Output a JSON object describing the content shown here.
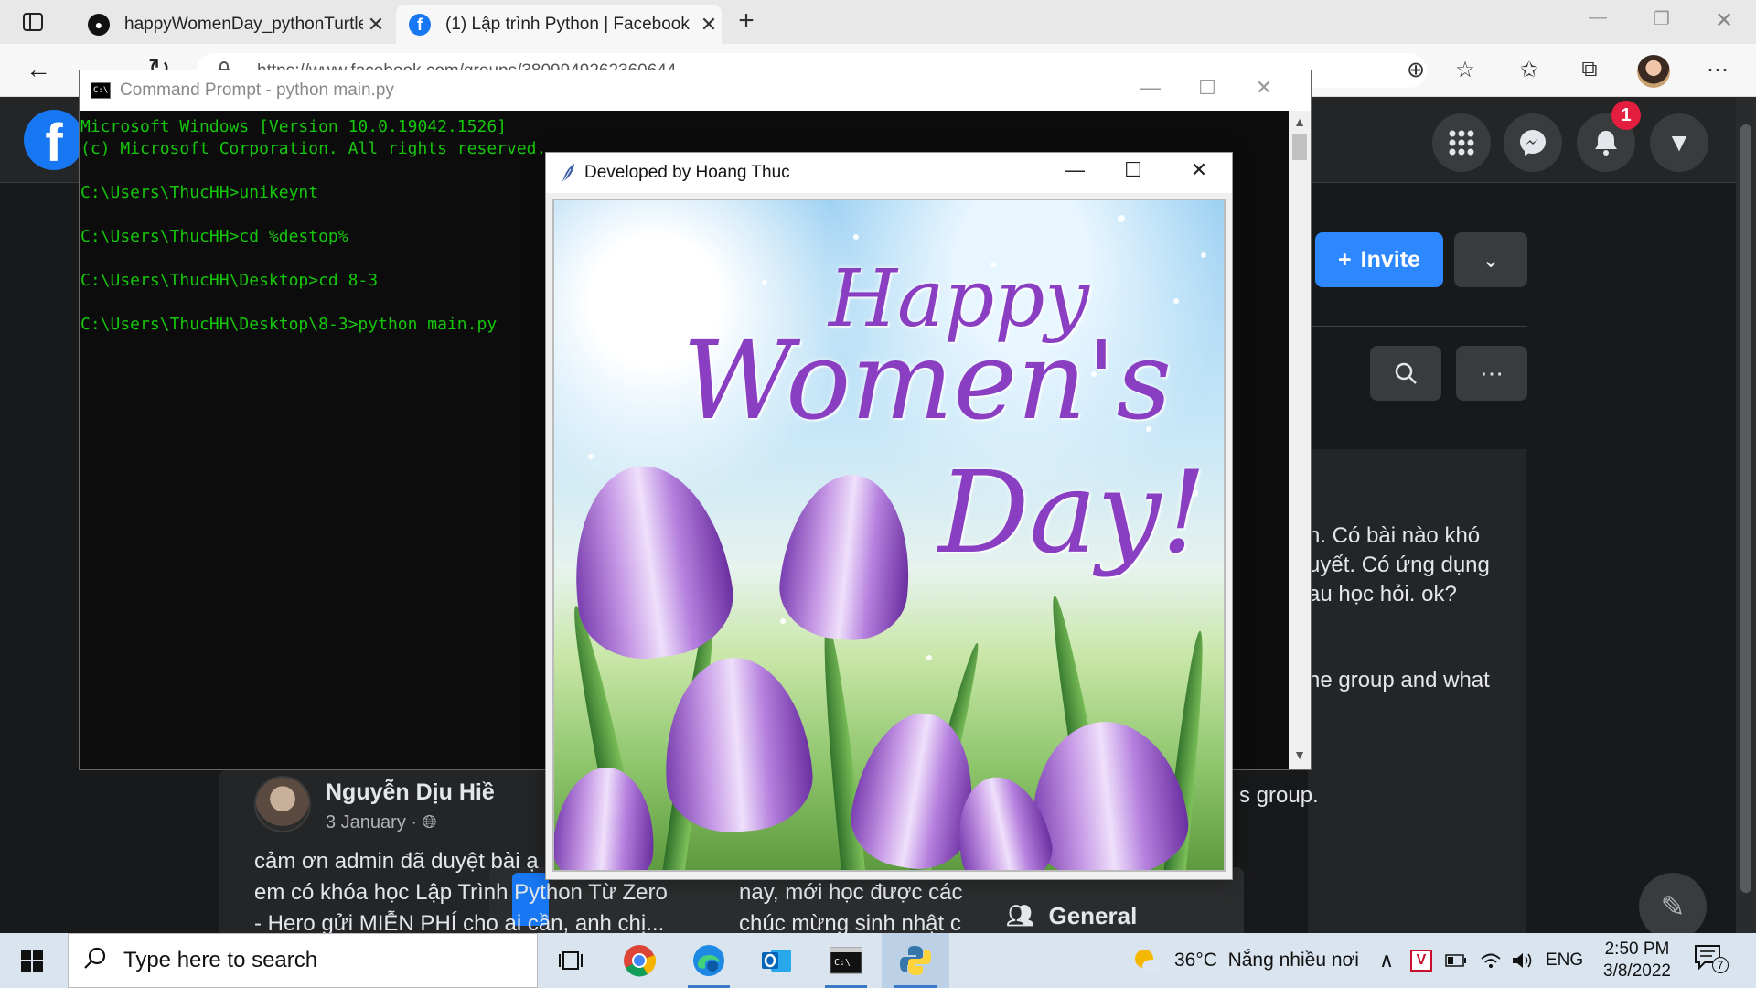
{
  "browser": {
    "tabs": [
      {
        "title": "happyWomenDay_pythonTurtle/",
        "icon": "github-icon"
      },
      {
        "title": "(1) Lập trình Python | Facebook",
        "icon": "facebook-icon"
      }
    ],
    "url": "https://www.facebook.com/groups/3809949262360644"
  },
  "facebook": {
    "notification_count": "1",
    "invite_label": "Invite",
    "about_lines": [
      "n. Có bài nào khó",
      "uyết. Có ứng dụng",
      "au học hỏi. ok?",
      "he group and what",
      "s group."
    ],
    "post": {
      "author": "Nguyễn Dịu Hiề",
      "date": "3 January ·",
      "lines": [
        "cảm ơn admin đã duyệt bài ạ",
        "em có khóa học Lập Trình Python Từ Zero",
        "- Hero gửi MIỄN PHÍ cho ai cần, anh chị..."
      ]
    },
    "post2_lines": [
      "nay, mới học được các",
      "chúc mừng sinh nhật c"
    ],
    "general_label": "General"
  },
  "cmd": {
    "title": "Command Prompt - python  main.py",
    "lines": [
      "Microsoft Windows [Version 10.0.19042.1526]",
      "(c) Microsoft Corporation. All rights reserved.",
      "",
      "C:\\Users\\ThucHH>unikeynt",
      "",
      "C:\\Users\\ThucHH>cd %destop%",
      "",
      "C:\\Users\\ThucHH\\Desktop>cd 8-3",
      "",
      "C:\\Users\\ThucHH\\Desktop\\8-3>python main.py"
    ]
  },
  "turtle": {
    "title": "Developed by Hoang Thuc",
    "greeting": {
      "line1": "Happy",
      "line2": "Women's",
      "line3": "Day!"
    }
  },
  "taskbar": {
    "search_placeholder": "Type here to search",
    "weather": "36°C  Nắng nhiều nơi",
    "language": "ENG",
    "time": "2:50 PM",
    "date": "3/8/2022",
    "notification_count": "7",
    "apps": [
      "task-view",
      "chrome",
      "edge",
      "outlook",
      "terminal",
      "python"
    ]
  },
  "colors": {
    "facebook_blue": "#1877f2",
    "console_green": "#16c60c",
    "greeting_purple": "#8a3fc2"
  }
}
